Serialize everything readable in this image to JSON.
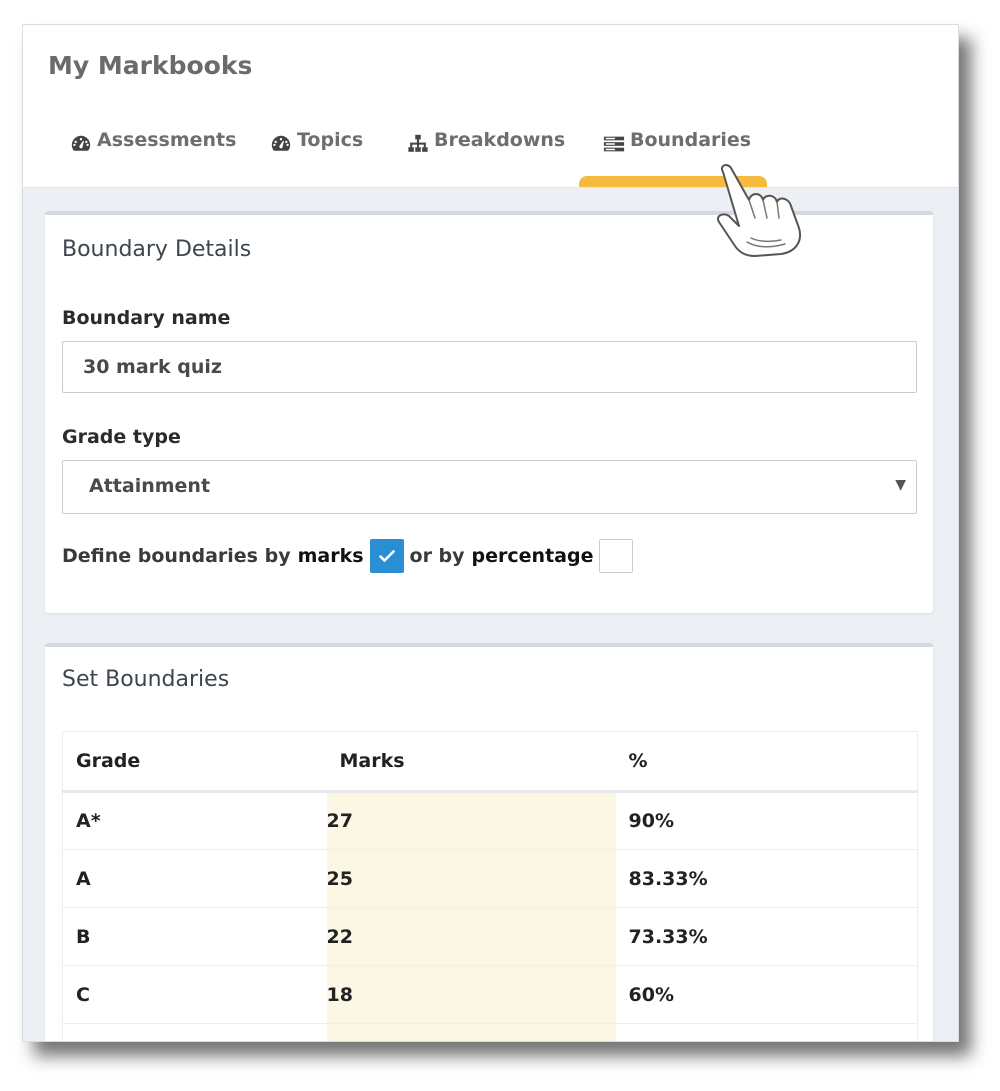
{
  "app": {
    "title": "My Markbooks"
  },
  "tabs": [
    {
      "label": "Assessments",
      "icon": "dashboard-icon"
    },
    {
      "label": "Topics",
      "icon": "dashboard-icon"
    },
    {
      "label": "Breakdowns",
      "icon": "sitemap-icon"
    },
    {
      "label": "Boundaries",
      "icon": "list-icon",
      "active": true
    }
  ],
  "boundary_details": {
    "title": "Boundary Details",
    "name_label": "Boundary name",
    "name_value": "30 mark quiz",
    "grade_type_label": "Grade type",
    "grade_type_value": "Attainment",
    "define_text": "Define boundaries by",
    "marks_word": "marks",
    "marks_checked": true,
    "or_text": "or by",
    "percentage_word": "percentage",
    "percentage_checked": false
  },
  "set_boundaries": {
    "title": "Set Boundaries",
    "columns": [
      "Grade",
      "Marks",
      "%"
    ],
    "rows": [
      {
        "grade": "A*",
        "marks": "27",
        "percent": "90%"
      },
      {
        "grade": "A",
        "marks": "25",
        "percent": "83.33%"
      },
      {
        "grade": "B",
        "marks": "22",
        "percent": "73.33%"
      },
      {
        "grade": "C",
        "marks": "18",
        "percent": "60%"
      },
      {
        "grade": "",
        "marks": "",
        "percent": ""
      }
    ]
  },
  "colors": {
    "active_tab_indicator": "#f6bb3e",
    "checkbox_checked": "#2a8ed3",
    "marks_column_bg": "#fcf6e4"
  }
}
